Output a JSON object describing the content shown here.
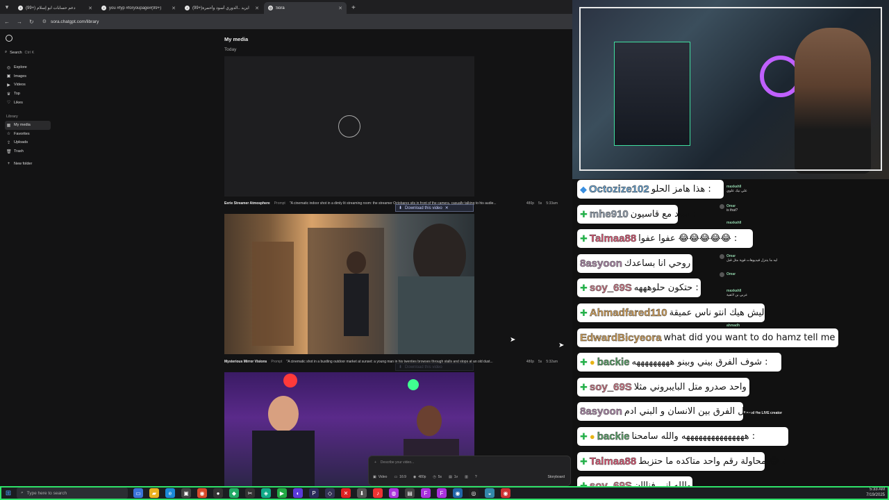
{
  "browser": {
    "tabs": [
      {
        "title": "(99+) دعم حسابات ابو إسلام",
        "icon": "tiktok-icon",
        "active": false
      },
      {
        "title": "you #fyp #foryoupage#(99+)",
        "icon": "tiktok-icon",
        "active": false
      },
      {
        "title": "(99+)ايزيد ..الدوري أسود وأحمرة",
        "icon": "tiktok-icon",
        "active": false
      },
      {
        "title": "Sora",
        "icon": "sora-icon",
        "active": true
      }
    ],
    "url": "sora.chatgpt.com/library"
  },
  "sidebar": {
    "search_label": "Search",
    "search_shortcut": "Ctrl K",
    "items": [
      {
        "label": "Explore",
        "icon": "compass-icon"
      },
      {
        "label": "Images",
        "icon": "image-icon"
      },
      {
        "label": "Videos",
        "icon": "video-icon"
      },
      {
        "label": "Top",
        "icon": "trophy-icon"
      },
      {
        "label": "Likes",
        "icon": "heart-icon"
      }
    ],
    "library_label": "Library",
    "library_items": [
      {
        "label": "My media",
        "icon": "grid-icon",
        "active": true
      },
      {
        "label": "Favorites",
        "icon": "star-icon"
      },
      {
        "label": "Uploads",
        "icon": "upload-icon"
      },
      {
        "label": "Trash",
        "icon": "trash-icon"
      }
    ],
    "new_folder_label": "New folder"
  },
  "main": {
    "title": "My media",
    "section": "Today",
    "videos": [
      {
        "title": "Eerie Streamer Atmosphere",
        "prompt_label": "Prompt",
        "prompt": "\"A cinematic indoor shot in a dimly lit streaming room: the streamer Octobarex sits in front of the camera, casually talking to his audie...",
        "resolution": "480p",
        "duration": "5s",
        "time": "5:33am"
      },
      {
        "title": "Mysterious Mirror Visions",
        "prompt_label": "Prompt",
        "prompt": "\"A cinematic shot in a bustling outdoor market at sunset: a young man in his twenties browses through stalls and stops at an old dust...",
        "resolution": "480p",
        "duration": "5s",
        "time": "5:32am"
      }
    ],
    "download_label": "Download this video",
    "composer": {
      "placeholder": "Describe your video...",
      "type": "Video",
      "aspect": "16:9",
      "resolution": "480p",
      "duration": "5s",
      "variations": "1v",
      "storyboard": "Storyboard"
    }
  },
  "stream_chat": {
    "messages": [
      {
        "user": "Octozize102",
        "user_color": "#6aa8d8",
        "badge": "diamond",
        "text": "هذا هامز الحلو :"
      },
      {
        "user": "mhe910",
        "user_color": "#9aa8b8",
        "badge": "gem",
        "text": "سند مع قاسيون :"
      },
      {
        "user": "Talmaa88",
        "user_color": "#e85c7a",
        "badge": "gem",
        "text": "عفوا عفوا 😂😂😂😂😂 :"
      },
      {
        "user": "8asyoon",
        "user_color": "#b48cb0",
        "badge": "",
        "text": "روحي انا بساعدك :"
      },
      {
        "user": "soy_69S",
        "user_color": "#d57b8a",
        "badge": "gem",
        "text": "حتكون حلوهههه :"
      },
      {
        "user": "Ahmadfared110",
        "user_color": "#d9a55b",
        "badge": "gem",
        "text": "ليش هيك انتو ناس عميقة :"
      },
      {
        "user": "EdwardBicyeora",
        "user_color": "#d9a55b",
        "badge": "",
        "text": "what did you want to do hamz tell me :"
      },
      {
        "user": "backie",
        "user_color": "#5aa86a",
        "badge": "gem-coin",
        "text": "شوف الفرق بيني وبينو هههههههههه :"
      },
      {
        "user": "soy_69S",
        "user_color": "#d57b8a",
        "badge": "gem",
        "text": "واحد صدرو متل البايبروني مثلا :"
      },
      {
        "user": "8asyoon",
        "user_color": "#b48cb0",
        "badge": "",
        "text": "متل الفرق بين الانسان و البني ادم :"
      },
      {
        "user": "backie",
        "user_color": "#5aa86a",
        "badge": "gem-coin",
        "text": "هههههههههههههههه والله سامحنا :"
      },
      {
        "user": "Talmaa88",
        "user_color": "#e85c7a",
        "badge": "gem",
        "text": "محاولة رقم واحد متاكده ما حتزبط 😂 :"
      },
      {
        "user": "soy_69S",
        "user_color": "#d57b8a",
        "badge": "gem",
        "text": "والله اني فنااان :"
      }
    ],
    "mini_chat": [
      {
        "user": "maxkahll",
        "text": "علي نيك علوي"
      },
      {
        "user": "Omar",
        "text": "is that?"
      },
      {
        "user": "maxkahll",
        "text": ""
      },
      {
        "user": "Omar",
        "text": "ليه ما يتنزل فيديوهات قوية مثل قبل"
      },
      {
        "user": "Omar",
        "text": ""
      },
      {
        "user": "maxkahll",
        "text": "عربي بن لاتفية"
      },
      {
        "user": "ahmadh",
        "text": ""
      },
      {
        "user": "",
        "text": "followed the LIVE creator"
      }
    ]
  },
  "taskbar": {
    "search_placeholder": "Type here to search",
    "time": "5:33 AM",
    "date": "7/19/2025"
  }
}
